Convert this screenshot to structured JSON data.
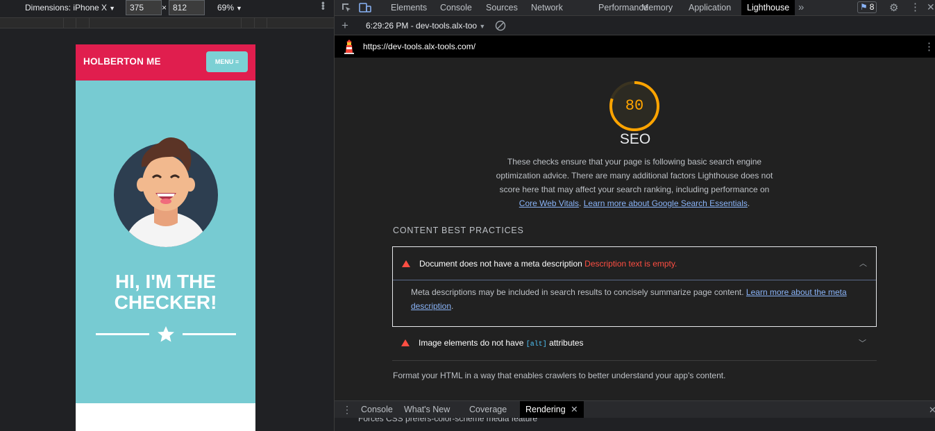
{
  "device_toolbar": {
    "dimensions_label": "Dimensions: iPhone X",
    "width": "375",
    "height": "812",
    "times": "×",
    "zoom": "69%"
  },
  "phone": {
    "logo": "HOLBERTON ME",
    "menu_label": "MENU ≡",
    "hero_title_line1": "HI, I'M THE",
    "hero_title_line2": "CHECKER!",
    "colors": {
      "header": "#e01e4e",
      "hero": "#77cbd2",
      "menu": "#7cd0d4"
    }
  },
  "devtools": {
    "tabs": [
      "Elements",
      "Console",
      "Sources",
      "Network",
      "Performance",
      "Memory",
      "Application",
      "Lighthouse"
    ],
    "active_tab": "Lighthouse",
    "more_tabs": "»",
    "issues_count": "8",
    "report_selector": "6:29:26 PM - dev-tools.alx-too",
    "url": "https://dev-tools.alx-tools.com/"
  },
  "lighthouse": {
    "score": "80",
    "score_value": 0.8,
    "score_color": "#ffa400",
    "category": "SEO",
    "description": "These checks ensure that your page is following basic search engine optimization advice. There are many additional factors Lighthouse does not score here that may affect your search ranking, including performance on",
    "link1": "Core Web Vitals",
    "link_sep": ".",
    "link2": "Learn more about Google Search Essentials",
    "link2_end": ".",
    "section_title": "CONTENT BEST PRACTICES",
    "audits": [
      {
        "title": "Document does not have a meta description",
        "error": "Description text is empty.",
        "body": "Meta descriptions may be included in search results to concisely summarize page content.",
        "body_link": "Learn more about the meta description",
        "body_end": "."
      },
      {
        "title_pre": "Image elements do not have",
        "code": "[alt]",
        "title_post": "attributes"
      }
    ],
    "footer_note": "Format your HTML in a way that enables crawlers to better understand your app's content."
  },
  "drawer": {
    "tabs": [
      "Console",
      "What's New",
      "Coverage",
      "Rendering"
    ],
    "active_tab": "Rendering",
    "partial_line": "Forces CSS prefers-color-scheme media feature"
  }
}
